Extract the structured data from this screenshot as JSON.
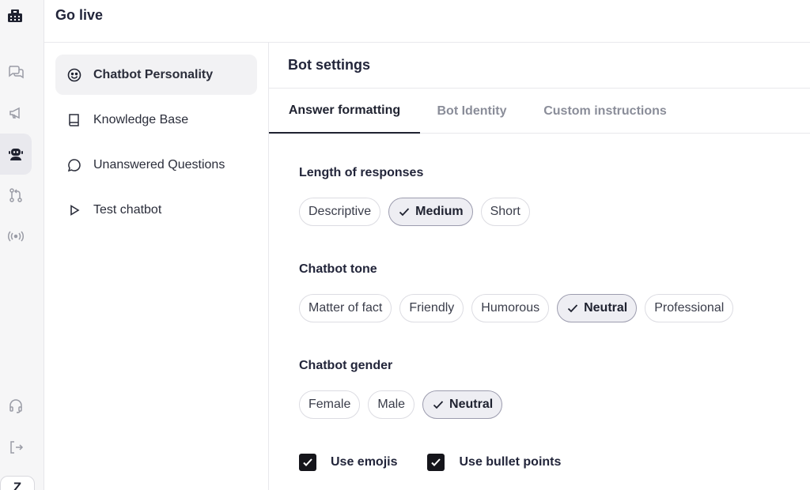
{
  "header": {
    "title": "Go live"
  },
  "rail": {
    "logo_icon": "building-logo",
    "icons": [
      "chat-bubbles-icon",
      "megaphone-icon",
      "bot-icon",
      "git-pull-request-icon",
      "broadcast-icon"
    ],
    "bottom_icons": [
      "headset-icon",
      "logout-icon"
    ],
    "workspace_badge": "Z"
  },
  "menu": {
    "items": [
      {
        "label": "Chatbot Personality",
        "icon": "smile-icon",
        "active": true
      },
      {
        "label": "Knowledge Base",
        "icon": "book-icon"
      },
      {
        "label": "Unanswered Questions",
        "icon": "speech-bubble-icon"
      },
      {
        "label": "Test chatbot",
        "icon": "play-icon"
      }
    ]
  },
  "main": {
    "title": "Bot settings",
    "tabs": [
      {
        "label": "Answer formatting",
        "active": true
      },
      {
        "label": "Bot Identity"
      },
      {
        "label": "Custom instructions"
      }
    ],
    "length": {
      "label": "Length of responses",
      "options": [
        "Descriptive",
        "Medium",
        "Short"
      ],
      "selected": "Medium"
    },
    "tone": {
      "label": "Chatbot tone",
      "options": [
        "Matter of fact",
        "Friendly",
        "Humorous",
        "Neutral",
        "Professional"
      ],
      "selected": "Neutral"
    },
    "gender": {
      "label": "Chatbot gender",
      "options": [
        "Female",
        "Male",
        "Neutral"
      ],
      "selected": "Neutral"
    },
    "checkboxes": {
      "emojis": {
        "label": "Use emojis",
        "checked": true
      },
      "bullets": {
        "label": "Use bullet points",
        "checked": true
      }
    }
  }
}
